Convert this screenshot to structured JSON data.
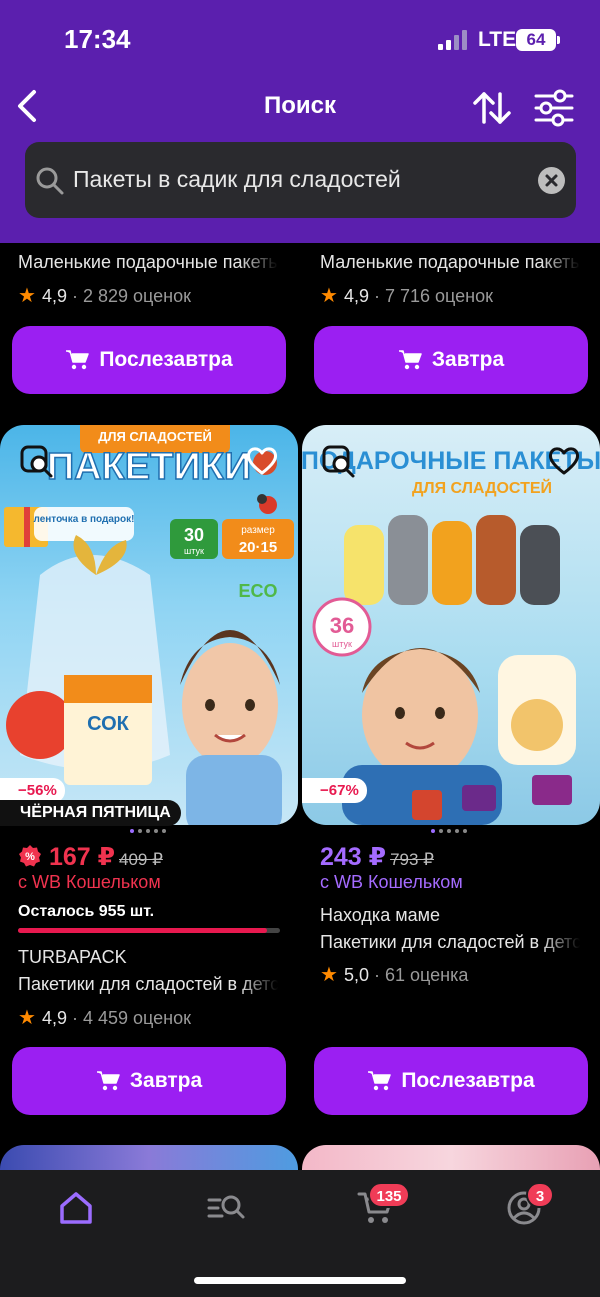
{
  "status_bar": {
    "time": "17:34",
    "network": "LTE",
    "battery": "64"
  },
  "nav": {
    "title": "Поиск"
  },
  "search": {
    "query": "Пакеты в садик для сладостей"
  },
  "top_row": [
    {
      "title": "Маленькие подарочные пакеты",
      "rating": "4,9",
      "reviews": "· 2 829 оценок",
      "button": "Послезавтра"
    },
    {
      "title": "Маленькие подарочные пакеты",
      "rating": "4,9",
      "reviews": "· 7 716 оценок",
      "button": "Завтра"
    }
  ],
  "products": [
    {
      "image_text": {
        "banner": "ДЛЯ СЛАДОСТЕЙ",
        "headline": "ПАКЕТИКИ",
        "ribbon": "ленточка в подарок!",
        "count": "30",
        "count_unit": "штук",
        "size_label": "размер",
        "size": "20·15",
        "eco": "ECO",
        "juice": "СОК"
      },
      "discount": "−56%",
      "promo": "ЧЁРНАЯ ПЯТНИЦА",
      "price": "167 ₽",
      "old_price": "409 ₽",
      "wallet": "с WB Кошельком",
      "stock": "Осталось 955 шт.",
      "stock_fraction": 0.95,
      "brand": "TURBAPACK",
      "title": "Пакетики для сладостей в детский сад",
      "rating": "4,9",
      "reviews": "· 4 459 оценок",
      "button": "Завтра"
    },
    {
      "image_text": {
        "headline": "ПОДАРОЧНЫЕ ПАКЕТЫ",
        "subline": "ДЛЯ СЛАДОСТЕЙ",
        "count": "36",
        "count_unit": "штук"
      },
      "discount": "−67%",
      "price": "243 ₽",
      "old_price": "793 ₽",
      "wallet": "с WB Кошельком",
      "brand": "Находка маме",
      "title": "Пакетики для сладостей в детский сад",
      "rating": "5,0",
      "reviews": "· 61 оценка",
      "button": "Послезавтра"
    }
  ],
  "tabbar": {
    "cart_badge": "135",
    "profile_badge": "3"
  },
  "colors": {
    "accent": "#9b1ff2",
    "header": "#5b1fae",
    "sale": "#e8194f",
    "wallet_purple": "#a46bff"
  }
}
